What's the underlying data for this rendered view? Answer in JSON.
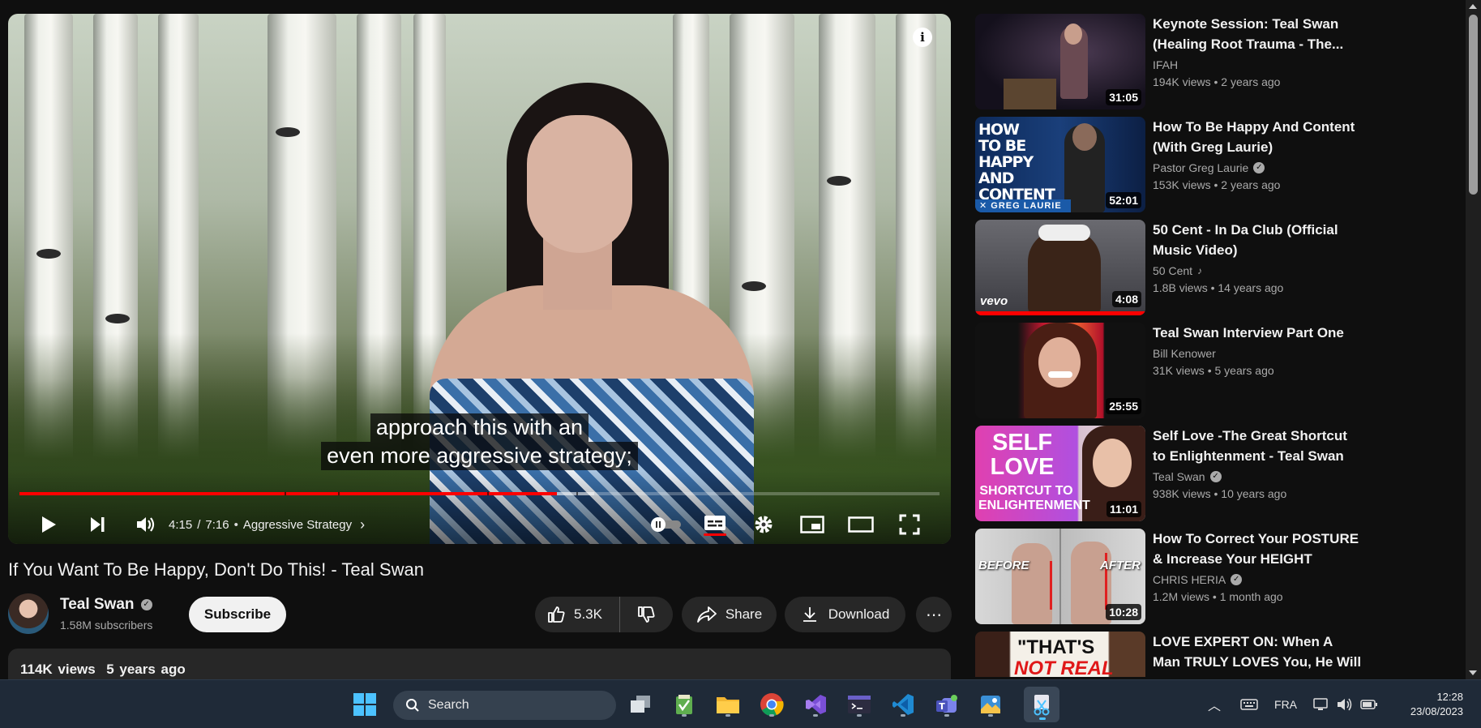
{
  "player": {
    "captions": [
      "approach this with an",
      "even more aggressive strategy;"
    ],
    "current_time": "4:15",
    "duration": "7:16",
    "time_separator": "/",
    "chapter_separator": "•",
    "chapter": "Aggressive Strategy",
    "progress_fraction": 0.584,
    "buffered_fraction": 0.625,
    "info_label": "i",
    "icons": [
      "play-icon",
      "next-icon",
      "volume-icon",
      "autoplay-toggle-icon",
      "subtitles-icon",
      "settings-icon",
      "miniplayer-icon",
      "theater-icon",
      "fullscreen-icon"
    ]
  },
  "video": {
    "title": "If You Want To Be Happy, Don't Do This! - Teal Swan",
    "channel_name": "Teal Swan",
    "subscribers": "1.58M subscribers",
    "subscribe_label": "Subscribe",
    "likes": "5.3K",
    "share_label": "Share",
    "download_label": "Download",
    "more_label": "⋯",
    "views": "114K views",
    "age": "5 years ago"
  },
  "related": [
    {
      "title": "Keynote Session: Teal Swan (Healing Root Trauma - The...",
      "channel": "IFAH",
      "verified": false,
      "music": false,
      "views": "194K views",
      "age": "2 years ago",
      "duration": "31:05"
    },
    {
      "title": "How To Be Happy And Content (With Greg Laurie)",
      "channel": "Pastor Greg Laurie",
      "verified": true,
      "music": false,
      "views": "153K views",
      "age": "2 years ago",
      "duration": "52:01",
      "thumb_text": "HOW TO BE HAPPY AND CONTENT",
      "thumb_sub": "✕ GREG LAURIE"
    },
    {
      "title": "50 Cent - In Da Club (Official Music Video)",
      "channel": "50 Cent",
      "verified": false,
      "music": true,
      "views": "1.8B views",
      "age": "14 years ago",
      "duration": "4:08",
      "thumb_text": "vevo"
    },
    {
      "title": "Teal Swan Interview Part One",
      "channel": "Bill Kenower",
      "verified": false,
      "music": false,
      "views": "31K views",
      "age": "5 years ago",
      "duration": "25:55"
    },
    {
      "title": "Self Love -The Great Shortcut to Enlightenment - Teal Swan",
      "channel": "Teal Swan",
      "verified": true,
      "music": false,
      "views": "938K views",
      "age": "10 years ago",
      "duration": "11:01",
      "thumb_text": "SELF LOVE",
      "thumb_sub": "SHORTCUT TO ENLIGHTENMENT"
    },
    {
      "title": "How To Correct Your POSTURE & Increase Your HEIGHT",
      "channel": "CHRIS HERIA",
      "verified": true,
      "music": false,
      "views": "1.2M views",
      "age": "1 month ago",
      "duration": "10:28",
      "thumb_text": "BEFORE",
      "thumb_sub": "AFTER"
    },
    {
      "title": "LOVE EXPERT ON: When A Man TRULY LOVES You, He Will DO...",
      "channel": "",
      "verified": false,
      "music": false,
      "views": "",
      "age": "",
      "duration": "",
      "thumb_text": "\"THAT'S",
      "thumb_sub": "NOT REAL"
    }
  ],
  "meta_separator": "•",
  "taskbar": {
    "search_placeholder": "Search",
    "language": "FRA",
    "time": "12:28",
    "date": "23/08/2023",
    "apps": [
      "windows-start-icon",
      "task-view-icon",
      "notepad-icon",
      "file-explorer-icon",
      "chrome-icon",
      "visual-studio-icon",
      "terminal-icon",
      "vscode-icon",
      "teams-icon",
      "gallery-icon",
      "snipping-tool-icon"
    ]
  },
  "colors": {
    "accent": "#ff0000",
    "background": "#0f0f0f",
    "surface": "#272727",
    "taskbar": "#1f2a38"
  }
}
